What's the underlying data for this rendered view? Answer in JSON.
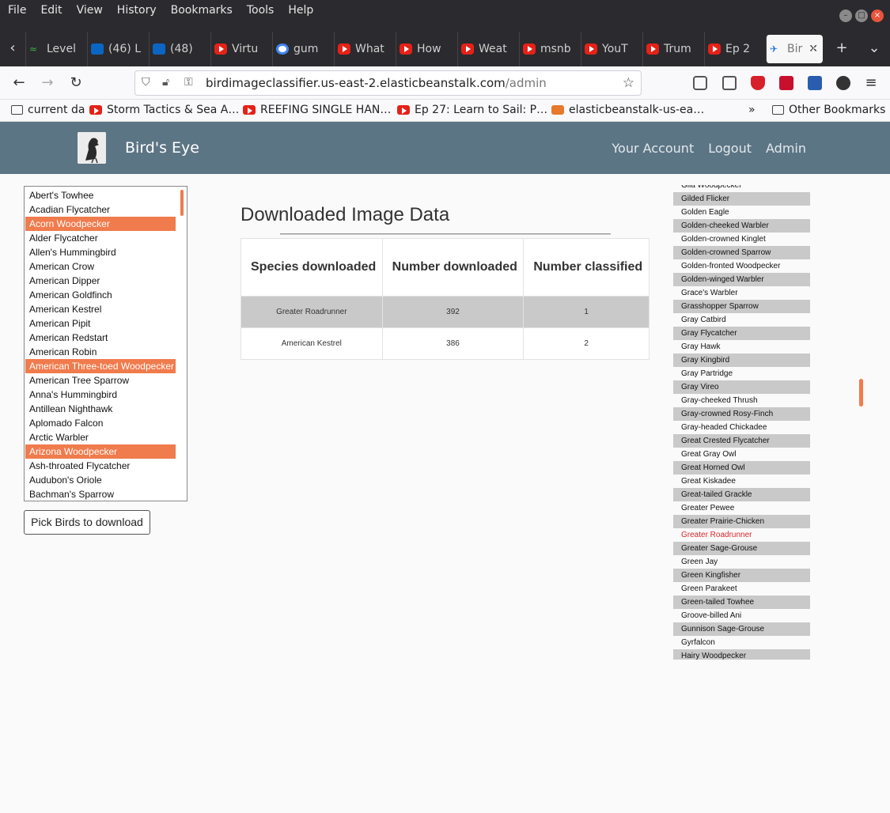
{
  "menu": [
    "File",
    "Edit",
    "View",
    "History",
    "Bookmarks",
    "Tools",
    "Help"
  ],
  "window_controls": [
    "minimize",
    "maximize",
    "close"
  ],
  "tabs": [
    {
      "label": "Level",
      "icon": "level-icon"
    },
    {
      "label": "(46) L",
      "icon": "linkedin-icon"
    },
    {
      "label": "(48) ",
      "icon": "linkedin-icon"
    },
    {
      "label": "Virtu",
      "icon": "youtube-icon"
    },
    {
      "label": "gum",
      "icon": "google-icon"
    },
    {
      "label": "What",
      "icon": "youtube-icon"
    },
    {
      "label": "How",
      "icon": "youtube-icon"
    },
    {
      "label": "Weat",
      "icon": "youtube-icon"
    },
    {
      "label": "msnb",
      "icon": "youtube-icon"
    },
    {
      "label": "YouT",
      "icon": "youtube-icon"
    },
    {
      "label": "Trum",
      "icon": "youtube-icon"
    },
    {
      "label": "Ep 2",
      "icon": "youtube-icon"
    },
    {
      "label": "Bir",
      "icon": "bird-icon",
      "active": true
    }
  ],
  "url": {
    "host": "birdimageclassifier.us-east-2.elasticbeanstalk.com",
    "path": "/admin"
  },
  "bookmarks": [
    {
      "label": "current da",
      "icon": "folder-icon"
    },
    {
      "label": "Storm Tactics & Sea A…",
      "icon": "youtube-icon"
    },
    {
      "label": "REEFING SINGLE HAN…",
      "icon": "youtube-icon"
    },
    {
      "label": "Ep 27: Learn to Sail: P…",
      "icon": "youtube-icon"
    },
    {
      "label": "elasticbeanstalk-us-ea…",
      "icon": "box-icon"
    }
  ],
  "other_bookmarks": "Other Bookmarks",
  "app": {
    "brand": "Bird's Eye",
    "nav": [
      "Your Account",
      "Logout",
      "Admin"
    ]
  },
  "left_list": {
    "items": [
      {
        "label": "Abert's Towhee",
        "selected": false
      },
      {
        "label": "Acadian Flycatcher",
        "selected": false
      },
      {
        "label": "Acorn Woodpecker",
        "selected": true
      },
      {
        "label": "Alder Flycatcher",
        "selected": false
      },
      {
        "label": "Allen's Hummingbird",
        "selected": false
      },
      {
        "label": "American Crow",
        "selected": false
      },
      {
        "label": "American Dipper",
        "selected": false
      },
      {
        "label": "American Goldfinch",
        "selected": false
      },
      {
        "label": "American Kestrel",
        "selected": false
      },
      {
        "label": "American Pipit",
        "selected": false
      },
      {
        "label": "American Redstart",
        "selected": false
      },
      {
        "label": "American Robin",
        "selected": false
      },
      {
        "label": "American Three-toed Woodpecker",
        "selected": true
      },
      {
        "label": "American Tree Sparrow",
        "selected": false
      },
      {
        "label": "Anna's Hummingbird",
        "selected": false
      },
      {
        "label": "Antillean Nighthawk",
        "selected": false
      },
      {
        "label": "Aplomado Falcon",
        "selected": false
      },
      {
        "label": "Arctic Warbler",
        "selected": false
      },
      {
        "label": "Arizona Woodpecker",
        "selected": true
      },
      {
        "label": "Ash-throated Flycatcher",
        "selected": false
      },
      {
        "label": "Audubon's Oriole",
        "selected": false
      },
      {
        "label": "Bachman's Sparrow",
        "selected": false
      }
    ],
    "button": "Pick Birds to download"
  },
  "table": {
    "title": "Downloaded Image Data",
    "headers": [
      "Species downloaded",
      "Number downloaded",
      "Number classified"
    ],
    "rows": [
      [
        "Greater Roadrunner",
        "392",
        "1"
      ],
      [
        "American Kestrel",
        "386",
        "2"
      ]
    ]
  },
  "right_list": {
    "items": [
      "Gila Woodpecker",
      "Gilded Flicker",
      "Golden Eagle",
      "Golden-cheeked Warbler",
      "Golden-crowned Kinglet",
      "Golden-crowned Sparrow",
      "Golden-fronted Woodpecker",
      "Golden-winged Warbler",
      "Grace's Warbler",
      "Grasshopper Sparrow",
      "Gray Catbird",
      "Gray Flycatcher",
      "Gray Hawk",
      "Gray Kingbird",
      "Gray Partridge",
      "Gray Vireo",
      "Gray-cheeked Thrush",
      "Gray-crowned Rosy-Finch",
      "Gray-headed Chickadee",
      "Great Crested Flycatcher",
      "Great Gray Owl",
      "Great Horned Owl",
      "Great Kiskadee",
      "Great-tailed Grackle",
      "Greater Pewee",
      "Greater Prairie-Chicken",
      "Greater Roadrunner",
      "Greater Sage-Grouse",
      "Green Jay",
      "Green Kingfisher",
      "Green Parakeet",
      "Green-tailed Towhee",
      "Groove-billed Ani",
      "Gunnison Sage-Grouse",
      "Gyrfalcon",
      "Hairy Woodpecker"
    ],
    "highlighted": "Greater Roadrunner"
  },
  "colors": {
    "selected": "#f07b4c",
    "header": "#5c7585",
    "highlight": "#d9262c",
    "shade": "#c9c9c9"
  }
}
